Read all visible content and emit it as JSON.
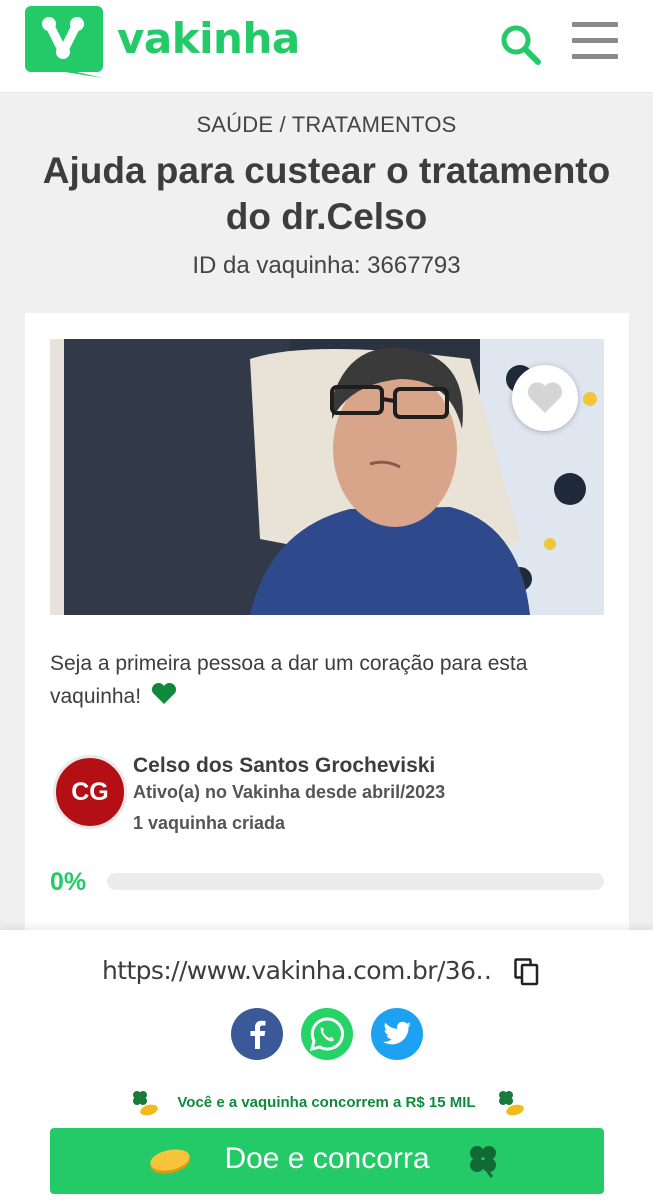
{
  "header": {
    "logo_text": "vakinha",
    "brand_color": "#24ca68",
    "icons": [
      "vakinha-logo-icon",
      "search-icon",
      "hamburger-menu-icon"
    ]
  },
  "campaign": {
    "category": "SAÚDE / TRATAMENTOS",
    "title": "Ajuda para custear o tratamento do dr.Celso",
    "id_label": "ID da vaquinha: 3667793",
    "heart_cta": "Seja a primeira pessoa a dar um coração para esta vaquinha!"
  },
  "owner": {
    "initials": "CG",
    "name": "Celso dos Santos Grocheviski",
    "since": "Ativo(a) no Vakinha desde abril/2023",
    "campaign_count": "1 vaquinha criada",
    "avatar_color": "#b30f14"
  },
  "progress": {
    "percent_label": "0%",
    "fraction": 0
  },
  "share": {
    "url": "https://www.vakinha.com.br/36…",
    "networks": [
      "facebook-icon",
      "whatsapp-icon",
      "twitter-icon"
    ]
  },
  "promo": {
    "text": "Você e a vaquinha concorrem a R$ 15 MIL"
  },
  "donate": {
    "label": "Doe e concorra"
  }
}
